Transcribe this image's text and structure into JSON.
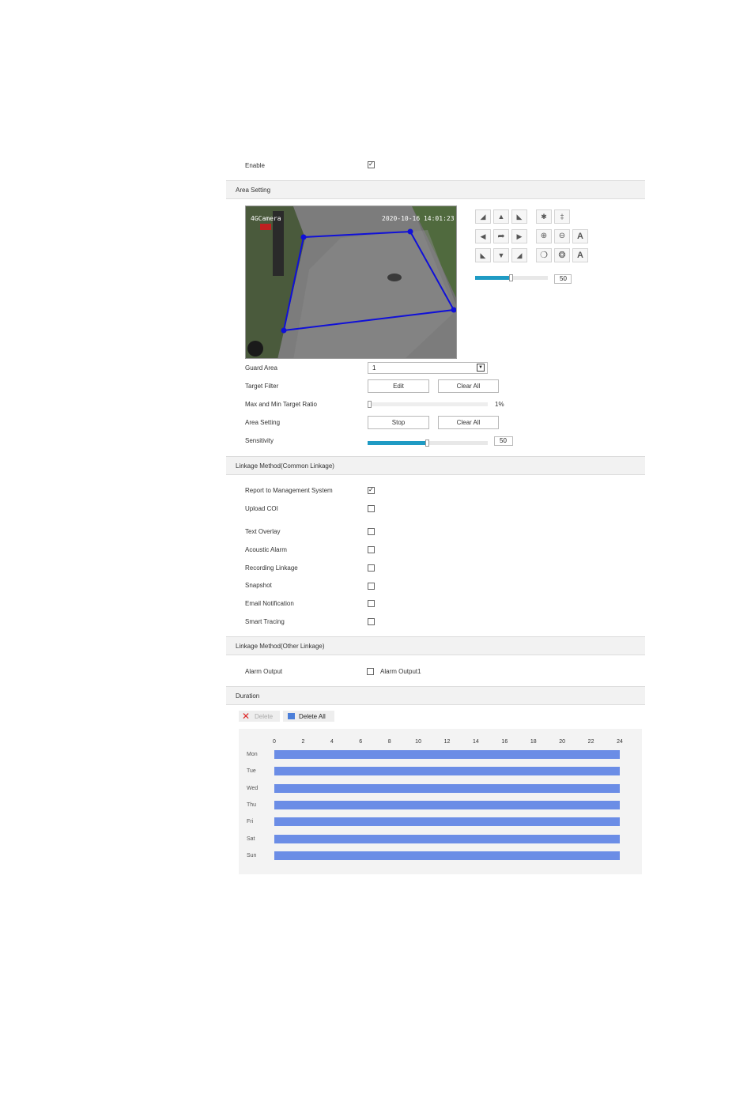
{
  "enable": {
    "label": "Enable",
    "checked": true
  },
  "area_section": {
    "title": "Area Setting"
  },
  "video": {
    "camera_label": "4GCamera",
    "timestamp": "2020-10-16 14:01:23",
    "overlay_color": "#1010d8"
  },
  "ptz": {
    "rows": [
      [
        "arrow-up-left-icon",
        "arrow-up-icon",
        "arrow-up-right-icon",
        "focus-near-icon",
        "focus-far-icon"
      ],
      [
        "arrow-left-icon",
        "rotate-icon",
        "arrow-right-icon",
        "zoom-in-icon",
        "zoom-out-icon",
        "auto-focus-icon"
      ],
      [
        "arrow-down-left-icon",
        "arrow-down-icon",
        "arrow-down-right-icon",
        "iris-open-icon",
        "iris-close-icon",
        "auto-iris-icon"
      ]
    ],
    "speed": 50,
    "speed_label": "50"
  },
  "guard_area": {
    "label": "Guard Area",
    "value": "1"
  },
  "target_filter": {
    "label": "Target Filter",
    "edit_label": "Edit",
    "clear_label": "Clear All"
  },
  "target_ratio": {
    "label": "Max and Min Target Ratio",
    "value": 1,
    "value_label": "1%"
  },
  "area_setting": {
    "label": "Area Setting",
    "stop_label": "Stop",
    "clear_label": "Clear All"
  },
  "sensitivity": {
    "label": "Sensitivity",
    "value": 50,
    "value_label": "50"
  },
  "common_linkage": {
    "title": "Linkage Method(Common Linkage)",
    "items": [
      {
        "label": "Report to Management System",
        "checked": true
      },
      {
        "label": "Upload COI",
        "checked": false
      },
      {
        "label": "Text Overlay",
        "checked": false
      },
      {
        "label": "Acoustic Alarm",
        "checked": false
      },
      {
        "label": "Recording Linkage",
        "checked": false
      },
      {
        "label": "Snapshot",
        "checked": false
      },
      {
        "label": "Email Notification",
        "checked": false
      },
      {
        "label": "Smart Tracing",
        "checked": false
      }
    ]
  },
  "other_linkage": {
    "title": "Linkage Method(Other Linkage)",
    "alarm_output_label": "Alarm Output",
    "alarm_output1_label": "Alarm Output1",
    "checked": false
  },
  "duration": {
    "title": "Duration",
    "delete_label": "Delete",
    "delete_all_label": "Delete All",
    "hours": [
      "0",
      "2",
      "4",
      "6",
      "8",
      "10",
      "12",
      "14",
      "16",
      "18",
      "20",
      "22",
      "24"
    ],
    "days": [
      "Mon",
      "Tue",
      "Wed",
      "Thu",
      "Fri",
      "Sat",
      "Sun"
    ],
    "bar_color": "#6b8de6"
  }
}
